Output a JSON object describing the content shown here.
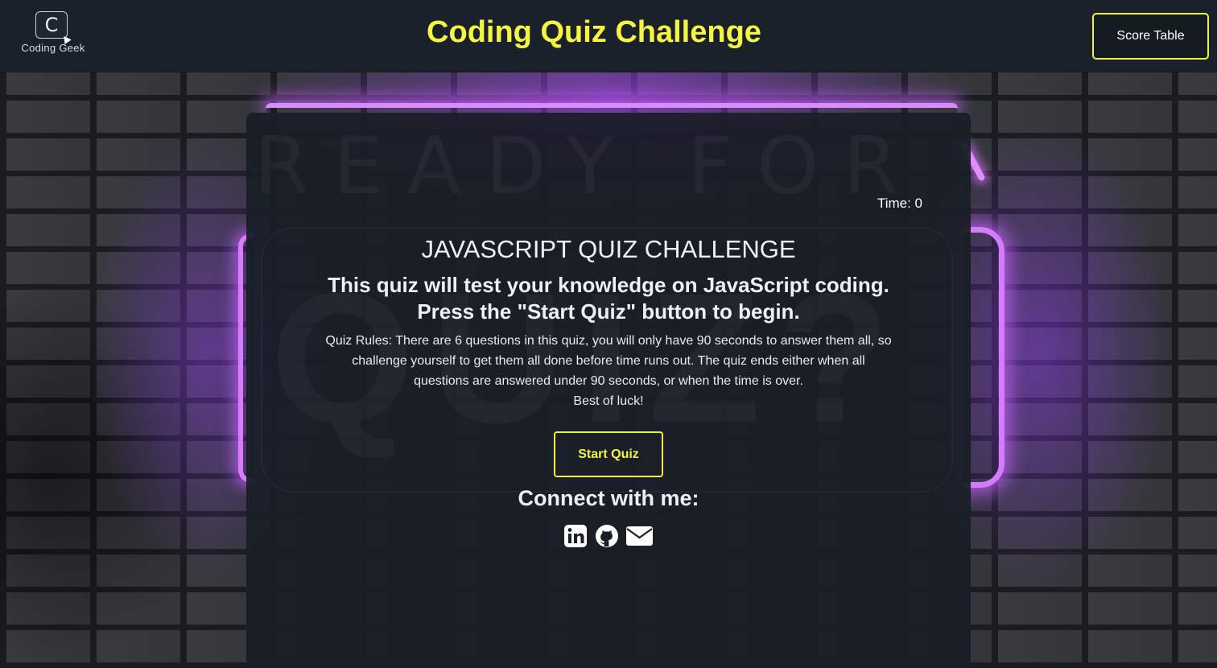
{
  "header": {
    "logo_letter": "C",
    "logo_text": "Coding Geek",
    "title": "Coding Quiz Challenge",
    "score_button": "Score Table"
  },
  "panel": {
    "background_text": "READY FOR A",
    "background_quiz_text": "QUIZ?",
    "timer": "Time: 0",
    "heading": "JAVASCRIPT QUIZ CHALLENGE",
    "subheading_line1": "This quiz will test your knowledge on JavaScript coding.",
    "subheading_line2": "Press the \"Start Quiz\" button to begin.",
    "rules": "Quiz Rules: There are 6 questions in this quiz, you will only have 90 seconds to answer them all, so challenge yourself to get them all done before time runs out. The quiz ends either when all questions are answered under 90 seconds, or when the time is over.",
    "luck": "Best of luck!",
    "start_button": "Start Quiz",
    "connect_title": "Connect with me:",
    "social_icons": [
      "linkedin-icon",
      "github-icon",
      "envelope-icon"
    ]
  },
  "colors": {
    "accent_yellow": "#f5f542",
    "header_bg": "#1b212b",
    "panel_bg": "#181e26",
    "neon_purple": "#d47bff"
  }
}
